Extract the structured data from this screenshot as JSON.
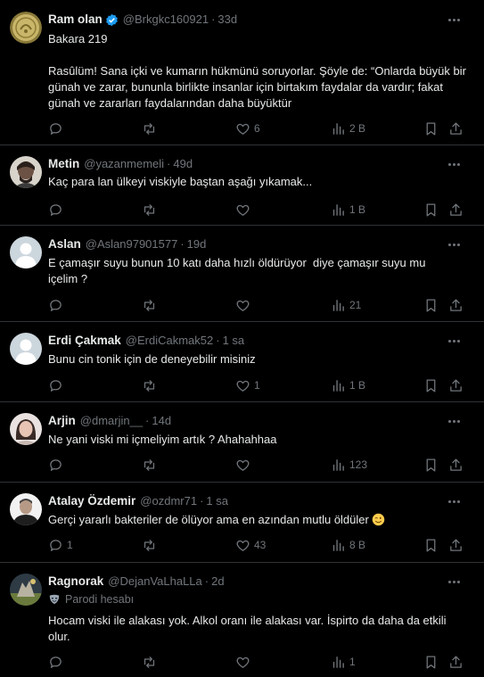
{
  "tweets": [
    {
      "name": "Ram olan",
      "verified": true,
      "handle": "@Brkgkc160921",
      "time": "33d",
      "text": "Bakara 219\n\nRasûlüm! Sana içki ve kumarın hükmünü soruyorlar. Şöyle de: “Onlarda büyük bir günah ve zarar, bununla birlikte insanlar için birtakım faydalar da vardır; fakat günah ve zararları faydalarından daha büyüktür",
      "replies": "",
      "retweets": "",
      "likes": "6",
      "views": "2 B",
      "avatar": "coin-avatar"
    },
    {
      "name": "Metin",
      "verified": false,
      "handle": "@yazanmemeli",
      "time": "49d",
      "text": "Kaç para lan ülkeyi viskiyle baştan aşağı yıkamak...",
      "replies": "",
      "retweets": "",
      "likes": "",
      "views": "1 B",
      "avatar": "photo-avatar"
    },
    {
      "name": "Aslan",
      "verified": false,
      "handle": "@Aslan97901577",
      "time": "19d",
      "text": "E çamaşır suyu bunun 10 katı daha hızlı öldürüyor  diye çamaşır suyu mu içelim ?",
      "replies": "",
      "retweets": "",
      "likes": "",
      "views": "21",
      "avatar": "default-avatar"
    },
    {
      "name": "Erdi Çakmak",
      "verified": false,
      "handle": "@ErdiCakmak52",
      "time": "1 sa",
      "text": "Bunu cin tonik için de deneyebilir misiniz",
      "replies": "",
      "retweets": "",
      "likes": "1",
      "views": "1 B",
      "avatar": "default-avatar"
    },
    {
      "name": "Arjin",
      "verified": false,
      "handle": "@dmarjin__",
      "time": "14d",
      "text": "Ne yani viski mi içmeliyim artık ? Ahahahhaa",
      "replies": "",
      "retweets": "",
      "likes": "",
      "views": "123",
      "avatar": "photo-avatar-2"
    },
    {
      "name": "Atalay Özdemir",
      "verified": false,
      "handle": "@ozdmr71",
      "time": "1 sa",
      "text": "Gerçi yararlı bakteriler de ölüyor ama en azından mutlu öldüler",
      "emoji": "winking-face-emoji",
      "replies": "1",
      "retweets": "",
      "likes": "43",
      "views": "8 B",
      "avatar": "photo-avatar-3"
    },
    {
      "name": "Ragnorak",
      "verified": false,
      "handle": "@DejanVaLhaLLa",
      "time": "2d",
      "parody": "Parodi hesabı",
      "text": "Hocam viski ile alakası yok. Alkol oranı ile alakası var. İspirto da daha da etkili olur.",
      "replies": "",
      "retweets": "",
      "likes": "",
      "views": "1",
      "avatar": "photo-avatar-4"
    }
  ],
  "sep": "·",
  "colors": {
    "background": "#000000",
    "text": "#e7e9ea",
    "muted": "#71767b",
    "divider": "#2f3336",
    "verified": "#1d9bf0"
  }
}
